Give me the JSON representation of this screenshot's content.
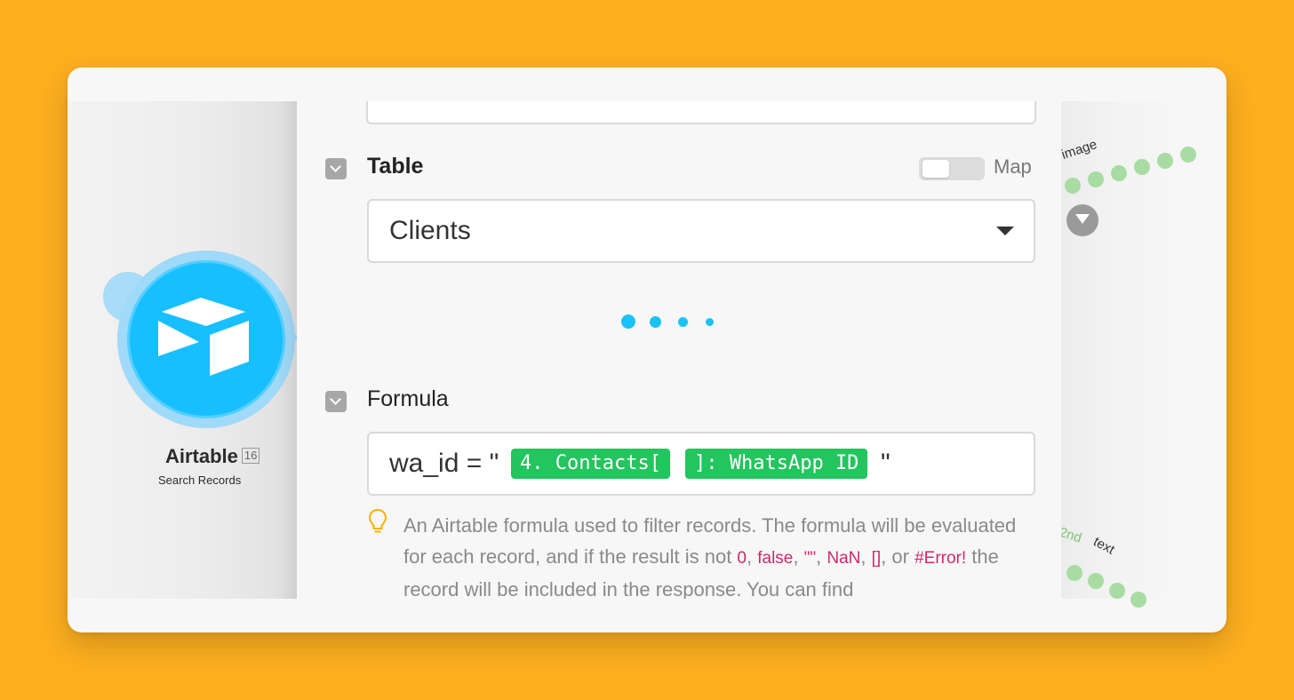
{
  "module": {
    "name": "Airtable",
    "count": "16",
    "subtitle": "Search Records",
    "brand_color": "#18bfff"
  },
  "table_section": {
    "label": "Table",
    "map_label": "Map",
    "map_toggle_on": false,
    "selected_value": "Clients"
  },
  "formula_section": {
    "label": "Formula",
    "prefix": "wa_id = \"",
    "pills": [
      "4. Contacts[",
      "]: WhatsApp ID"
    ],
    "pill_color": "#22c55e",
    "suffix": "\"",
    "hint": {
      "t1": "An Airtable formula used to filter records. The formula will be evaluated for each record, and if the result is not ",
      "c1": "0",
      "s1": ", ",
      "c2": "false",
      "s2": ", ",
      "c3": "\"\"",
      "s3": ", ",
      "c4": "NaN",
      "s4": ", ",
      "c5": "[]",
      "s5": ",",
      "t2": " or ",
      "c6": "#Error!",
      "t3": " the record will be included in the response. You can find"
    }
  },
  "canvas_right": {
    "label_image": "image",
    "label_2nd": "2nd",
    "label_text": "text"
  },
  "colors": {
    "background": "#fdaf1f",
    "loading_dots": "#1ac3f5",
    "code": "#cc2a6a"
  }
}
